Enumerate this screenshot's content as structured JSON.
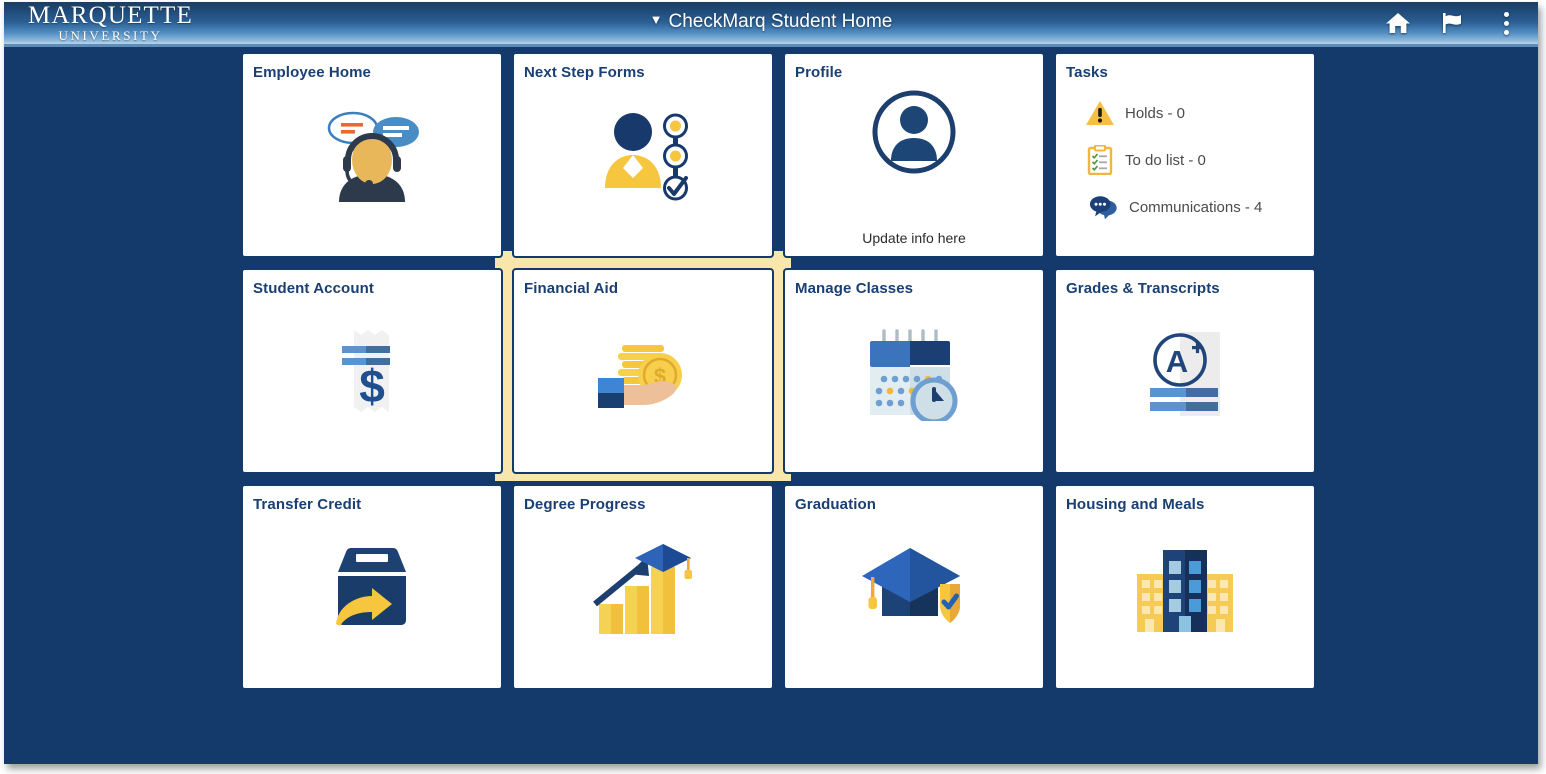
{
  "header": {
    "logo_main": "MARQUETTE",
    "logo_sub": "UNIVERSITY",
    "title": "CheckMarq Student Home",
    "caret": "▼",
    "icons": [
      {
        "name": "home-icon",
        "label": "Home"
      },
      {
        "name": "flag-icon",
        "label": "Notifications"
      },
      {
        "name": "actions-menu-icon",
        "label": "Actions"
      }
    ]
  },
  "colors": {
    "brand_navy": "#133a6b",
    "brand_gold": "#f6c244",
    "highlight": "#f9e6ab",
    "tile_background": "#ffffff",
    "page_background": "#143a6b"
  },
  "tiles": [
    {
      "title": "Employee Home",
      "icon": "support-agent-icon",
      "footer": ""
    },
    {
      "title": "Next Step Forms",
      "icon": "person-steps-icon",
      "footer": ""
    },
    {
      "title": "Profile",
      "icon": "user-avatar-icon",
      "footer": "Update info here"
    },
    {
      "title": "Tasks",
      "icon": "tasks-list-icon",
      "footer": ""
    },
    {
      "title": "Student Account",
      "icon": "receipt-dollar-icon",
      "footer": ""
    },
    {
      "title": "Financial Aid",
      "icon": "hand-coins-icon",
      "footer": "",
      "highlighted": true
    },
    {
      "title": "Manage Classes",
      "icon": "calendar-clock-icon",
      "footer": ""
    },
    {
      "title": "Grades & Transcripts",
      "icon": "grade-a-plus-icon",
      "footer": ""
    },
    {
      "title": "Transfer Credit",
      "icon": "box-arrow-icon",
      "footer": ""
    },
    {
      "title": "Degree Progress",
      "icon": "bar-chart-cap-icon",
      "footer": ""
    },
    {
      "title": "Graduation",
      "icon": "cap-shield-icon",
      "footer": ""
    },
    {
      "title": "Housing and Meals",
      "icon": "building-icon",
      "footer": ""
    }
  ],
  "tasks": [
    {
      "label": "Holds - 0",
      "icon": "warning-triangle-icon"
    },
    {
      "label": "To do list - 0",
      "icon": "clipboard-check-icon"
    },
    {
      "label": "Communications - 4",
      "icon": "speech-bubbles-icon"
    }
  ]
}
